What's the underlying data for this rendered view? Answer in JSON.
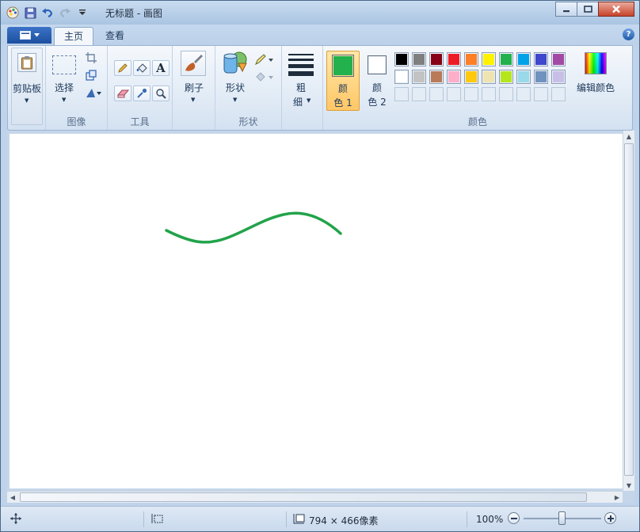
{
  "window": {
    "title": "无标题 - 画图"
  },
  "tabs": [
    {
      "label": "主页",
      "active": true
    },
    {
      "label": "查看",
      "active": false
    }
  ],
  "ribbon": {
    "clipboard": {
      "label": "剪贴板"
    },
    "image": {
      "select_label": "选择",
      "group_label": "图像"
    },
    "tools": {
      "group_label": "工具",
      "text_glyph": "A"
    },
    "brushes": {
      "label": "刷子"
    },
    "shapes": {
      "shapes_label": "形状",
      "group_label": "形状"
    },
    "size": {
      "label_line1": "粗",
      "label_line2": "细"
    },
    "colors": {
      "color1_line1": "颜",
      "color1_line2": "色 1",
      "color2_line1": "颜",
      "color2_line2": "色 2",
      "edit_label": "编辑颜色",
      "group_label": "颜色",
      "color1": "#22b14c",
      "color2": "#ffffff",
      "palette_row1": [
        "#000000",
        "#7f7f7f",
        "#880015",
        "#ed1c24",
        "#ff7f27",
        "#fff200",
        "#22b14c",
        "#00a2e8",
        "#3f48cc",
        "#a349a4"
      ],
      "palette_row2": [
        "#ffffff",
        "#c3c3c3",
        "#b97a57",
        "#ffaec9",
        "#ffc90e",
        "#efe4b0",
        "#b5e61d",
        "#99d9ea",
        "#7092be",
        "#c8bfe7"
      ]
    }
  },
  "canvas": {
    "stroke_color": "#22a34a"
  },
  "status": {
    "dimensions": "794 × 466像素",
    "zoom": "100%"
  }
}
